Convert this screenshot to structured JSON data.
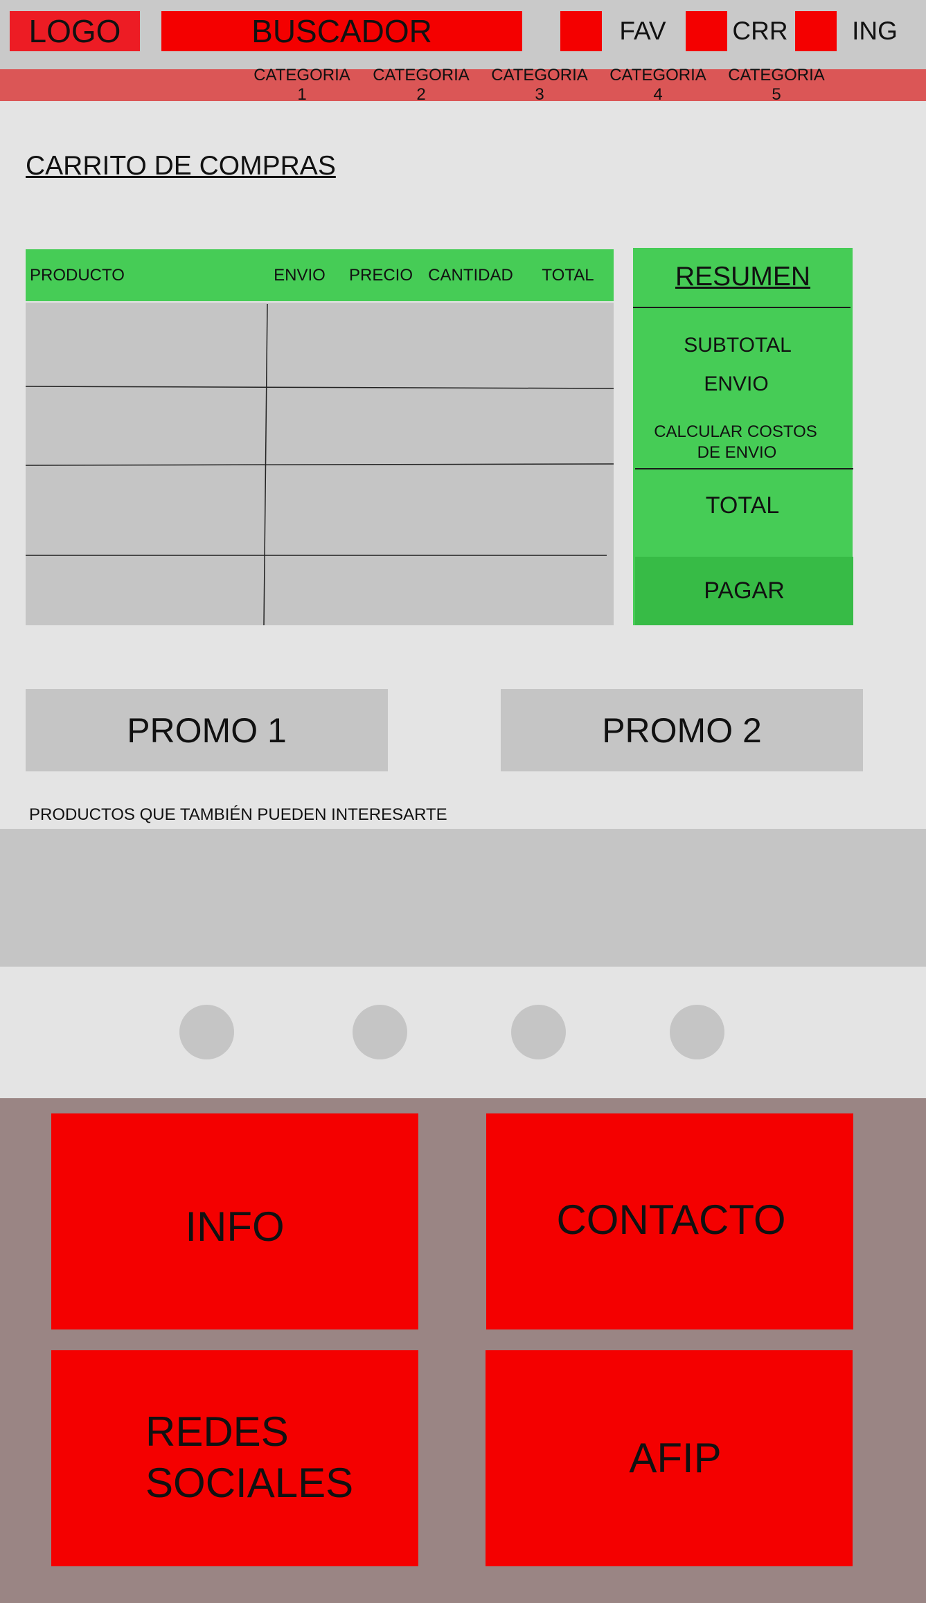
{
  "header": {
    "logo": "LOGO",
    "search": "BUSCADOR",
    "fav": "FAV",
    "cart": "CRR",
    "login": "ING"
  },
  "categories": [
    "CATEGORIA 1",
    "CATEGORIA 2",
    "CATEGORIA 3",
    "CATEGORIA 4",
    "CATEGORIA 5"
  ],
  "cart": {
    "title": "CARRITO DE COMPRAS",
    "columns": [
      "PRODUCTO",
      "ENVIO",
      "PRECIO",
      "CANTIDAD",
      "TOTAL"
    ]
  },
  "summary": {
    "title": "RESUMEN",
    "subtotal": "SUBTOTAL",
    "shipping": "ENVIO",
    "calc_line1": "CALCULAR COSTOS",
    "calc_line2": "DE ENVIO",
    "total": "TOTAL",
    "pay": "PAGAR"
  },
  "promos": [
    "PROMO 1",
    "PROMO 2"
  ],
  "recommended": {
    "label": "PRODUCTOS QUE TAMBIÉN PUEDEN INTERESARTE"
  },
  "footer": {
    "info": "INFO",
    "contact": "CONTACTO",
    "social_line1": "REDES",
    "social_line2": "SOCIALES",
    "afip": "AFIP"
  },
  "colors": {
    "red": "#f40000",
    "green": "#46cc56",
    "category_bar": "#db5656",
    "footer": "#9a8584"
  }
}
